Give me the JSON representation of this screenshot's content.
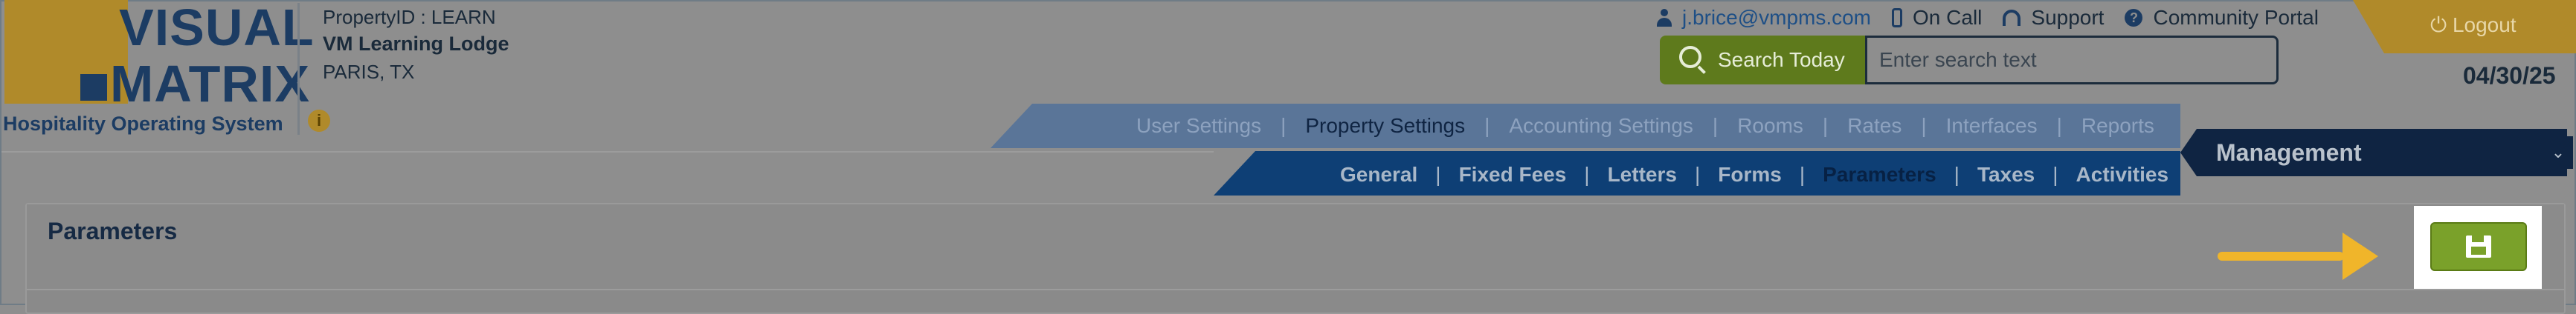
{
  "brand": {
    "logo_line1": "VISUAL",
    "logo_line2": "MATRIX",
    "tagline": "Hospitality Operating System",
    "info_icon_glyph": "i",
    "colors": {
      "gold": "#b08a2a",
      "navy": "#1c3c63"
    }
  },
  "property": {
    "id_line": "PropertyID : LEARN",
    "name": "VM Learning Lodge",
    "location": "PARIS, TX"
  },
  "top_links": {
    "user_email": "j.brice@vmpms.com",
    "on_call": "On Call",
    "support": "Support",
    "help_glyph": "?",
    "community_portal": "Community Portal",
    "icons": [
      "user-icon",
      "phone-icon",
      "headset-icon",
      "help-icon"
    ]
  },
  "logout": {
    "glyph": "⏻",
    "label": "Logout"
  },
  "date": "04/30/25",
  "search": {
    "button_label": "Search Today",
    "placeholder": "Enter search text",
    "value": ""
  },
  "primary_nav": {
    "items": [
      {
        "label": "User Settings",
        "active": false
      },
      {
        "label": "Property Settings",
        "active": true
      },
      {
        "label": "Accounting Settings",
        "active": false
      },
      {
        "label": "Rooms",
        "active": false
      },
      {
        "label": "Rates",
        "active": false
      },
      {
        "label": "Interfaces",
        "active": false
      },
      {
        "label": "Reports",
        "active": false
      }
    ]
  },
  "module": {
    "label": "Management",
    "chevron": "⌄"
  },
  "secondary_nav": {
    "items": [
      {
        "label": "General",
        "active": false
      },
      {
        "label": "Fixed Fees",
        "active": false
      },
      {
        "label": "Letters",
        "active": false
      },
      {
        "label": "Forms",
        "active": false
      },
      {
        "label": "Parameters",
        "active": true
      },
      {
        "label": "Taxes",
        "active": false
      },
      {
        "label": "Activities",
        "active": false
      }
    ]
  },
  "panel": {
    "title": "Parameters"
  },
  "save": {
    "icon": "save-icon",
    "highlight_arrow_color": "#f0b52a",
    "button_color": "#7aa12a"
  }
}
